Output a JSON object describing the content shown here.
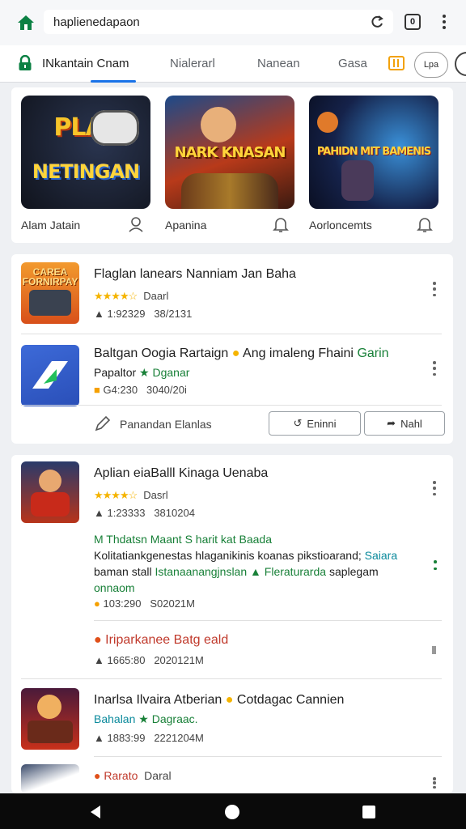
{
  "browser": {
    "url": "haplienedapaon",
    "tab_count": "0"
  },
  "tabs": [
    {
      "label": "INkantain Cnam"
    },
    {
      "label": "Nialerarl"
    },
    {
      "label": "Nanean"
    },
    {
      "label": "Gasa"
    },
    {
      "label": "Lpa"
    }
  ],
  "featured": [
    {
      "caption": "Alam Jatain",
      "art_text_top": "PLAY",
      "art_text": "NETINGAN",
      "icon": "person-icon"
    },
    {
      "caption": "Apanina",
      "art_text": "NARK KNASAN",
      "icon": "bell-icon"
    },
    {
      "caption": "Aorloncemts",
      "art_text": "PAHIDN MIT BAMENIS",
      "icon": "bell-icon"
    }
  ],
  "card1": {
    "item1": {
      "title": "Flaglan lanears Nanniam Jan Baha",
      "icon_text": "CAREA FORNIRPAY",
      "rating_label": "Daarl",
      "meta1": "1:92329",
      "meta2": "38/2131"
    },
    "item2": {
      "title_a": "Baltgan Oogia Rartaign",
      "title_b": "Ang imaleng Fhaini",
      "title_c": "Garin",
      "subtitle_a": "Papaltor",
      "subtitle_b": "Dganar",
      "meta1": "G4:230",
      "meta2": "3040/20i"
    },
    "footer_label": "Panandan Elanlas",
    "btn1": "Eninni",
    "btn2": "Nahl"
  },
  "card2": {
    "item1": {
      "title": "Aplian eiaBalll Kinaga Uenaba",
      "rating_label": "Dasrl",
      "meta1": "1:23333",
      "meta2": "3810204",
      "promo_title": "M Thdatsn Maant S harit kat Baada",
      "promo_line1_a": "Kolitatiankgenestas hlaganikinis koanas pikstioarand;",
      "promo_line1_b": "Saiara",
      "promo_line2_a": "baman stall",
      "promo_line2_b": "Istanaanangjnslan",
      "promo_line2_c": "Fleraturarda",
      "promo_line2_d": "saplegam",
      "promo_line3": "onnaom",
      "meta3": "103:290",
      "meta4": "S02021M"
    },
    "item2": {
      "title": "Iriparkanee Batg eald",
      "meta1": "1665:80",
      "meta2": "2020121M"
    },
    "item3": {
      "title_a": "Inarlsa Ilvaira Atberian",
      "title_b": "Cotdagac Cannien",
      "subtitle_a": "Bahalan",
      "subtitle_b": "Dagraac.",
      "meta1": "1883:99",
      "meta2": "2221204M"
    },
    "item4": {
      "title": "Rarato",
      "rating_label": "Daral"
    }
  },
  "colors": {
    "accent_green": "#0b8043",
    "accent_blue": "#1a73e8",
    "star": "#f5b400"
  }
}
